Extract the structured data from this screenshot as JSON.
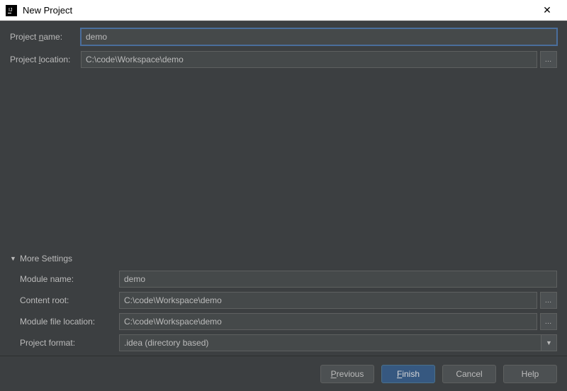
{
  "titlebar": {
    "title": "New Project"
  },
  "fields": {
    "project_name_label": "Project name:",
    "project_name_value": "demo",
    "project_location_label": "Project location:",
    "project_location_value": "C:\\code\\Workspace\\demo"
  },
  "more_settings": {
    "header": "More Settings",
    "module_name_label": "Module name:",
    "module_name_value": "demo",
    "content_root_label": "Content root:",
    "content_root_value": "C:\\code\\Workspace\\demo",
    "module_file_location_label": "Module file location:",
    "module_file_location_value": "C:\\code\\Workspace\\demo",
    "project_format_label": "Project format:",
    "project_format_value": ".idea (directory based)"
  },
  "buttons": {
    "previous": "Previous",
    "finish": "Finish",
    "cancel": "Cancel",
    "help": "Help"
  }
}
